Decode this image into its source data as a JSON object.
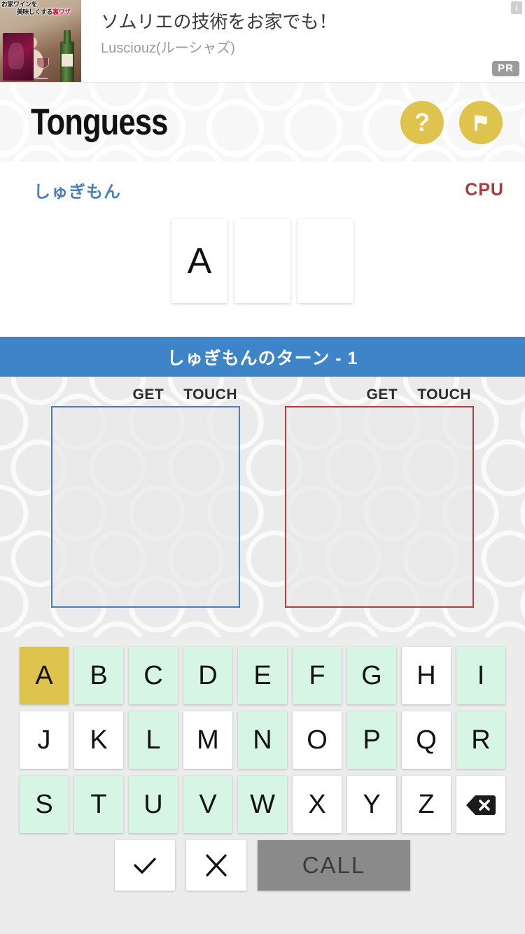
{
  "ad": {
    "title": "ソムリエの技術をお家でも！",
    "advertiser": "Lusciouz(ルーシャズ)",
    "pr_badge": "PR",
    "info_icon": "info-icon",
    "thumb_caption_line1": "お家ワインを",
    "thumb_caption_line2": "美味しくする",
    "thumb_caption_highlight": "裏ワザ"
  },
  "header": {
    "title": "Tonguess",
    "help_icon": "question-mark-icon",
    "flag_icon": "flag-icon",
    "accent_color": "#dfc34f"
  },
  "scoreboard": {
    "player_name": "しゅぎもん",
    "player_color": "#4a81b8",
    "cpu_name": "CPU",
    "cpu_color": "#ad3a3a",
    "cards": [
      "A",
      "",
      ""
    ]
  },
  "turn_banner": {
    "text": "しゅぎもんのターン - 1",
    "background_color": "#3d85c8"
  },
  "board": {
    "player_panel": {
      "get_label": "GET",
      "touch_label": "TOUCH",
      "border_color": "#4a7fb5",
      "rows": []
    },
    "cpu_panel": {
      "get_label": "GET",
      "touch_label": "TOUCH",
      "border_color": "#b04040",
      "rows": []
    }
  },
  "keyboard": {
    "rows": [
      [
        {
          "label": "A",
          "state": "selected"
        },
        {
          "label": "B",
          "state": "available"
        },
        {
          "label": "C",
          "state": "available"
        },
        {
          "label": "D",
          "state": "available"
        },
        {
          "label": "E",
          "state": "available"
        },
        {
          "label": "F",
          "state": "available"
        },
        {
          "label": "G",
          "state": "available"
        },
        {
          "label": "H",
          "state": "used"
        },
        {
          "label": "I",
          "state": "available"
        }
      ],
      [
        {
          "label": "J",
          "state": "used"
        },
        {
          "label": "K",
          "state": "used"
        },
        {
          "label": "L",
          "state": "available"
        },
        {
          "label": "M",
          "state": "used"
        },
        {
          "label": "N",
          "state": "available"
        },
        {
          "label": "O",
          "state": "used"
        },
        {
          "label": "P",
          "state": "available"
        },
        {
          "label": "Q",
          "state": "used"
        },
        {
          "label": "R",
          "state": "available"
        }
      ],
      [
        {
          "label": "S",
          "state": "available"
        },
        {
          "label": "T",
          "state": "available"
        },
        {
          "label": "U",
          "state": "available"
        },
        {
          "label": "V",
          "state": "available"
        },
        {
          "label": "W",
          "state": "available"
        },
        {
          "label": "X",
          "state": "used"
        },
        {
          "label": "Y",
          "state": "used"
        },
        {
          "label": "Z",
          "state": "used"
        },
        {
          "label": "",
          "state": "used",
          "icon": "backspace-icon"
        }
      ]
    ],
    "colors": {
      "available": "#d6f5e4",
      "selected": "#dfc34f",
      "used": "#ffffff"
    },
    "actions": {
      "confirm_icon": "check-icon",
      "cancel_icon": "close-icon",
      "call_label": "CALL",
      "call_enabled": false,
      "call_color": "#8a8a8a"
    }
  }
}
